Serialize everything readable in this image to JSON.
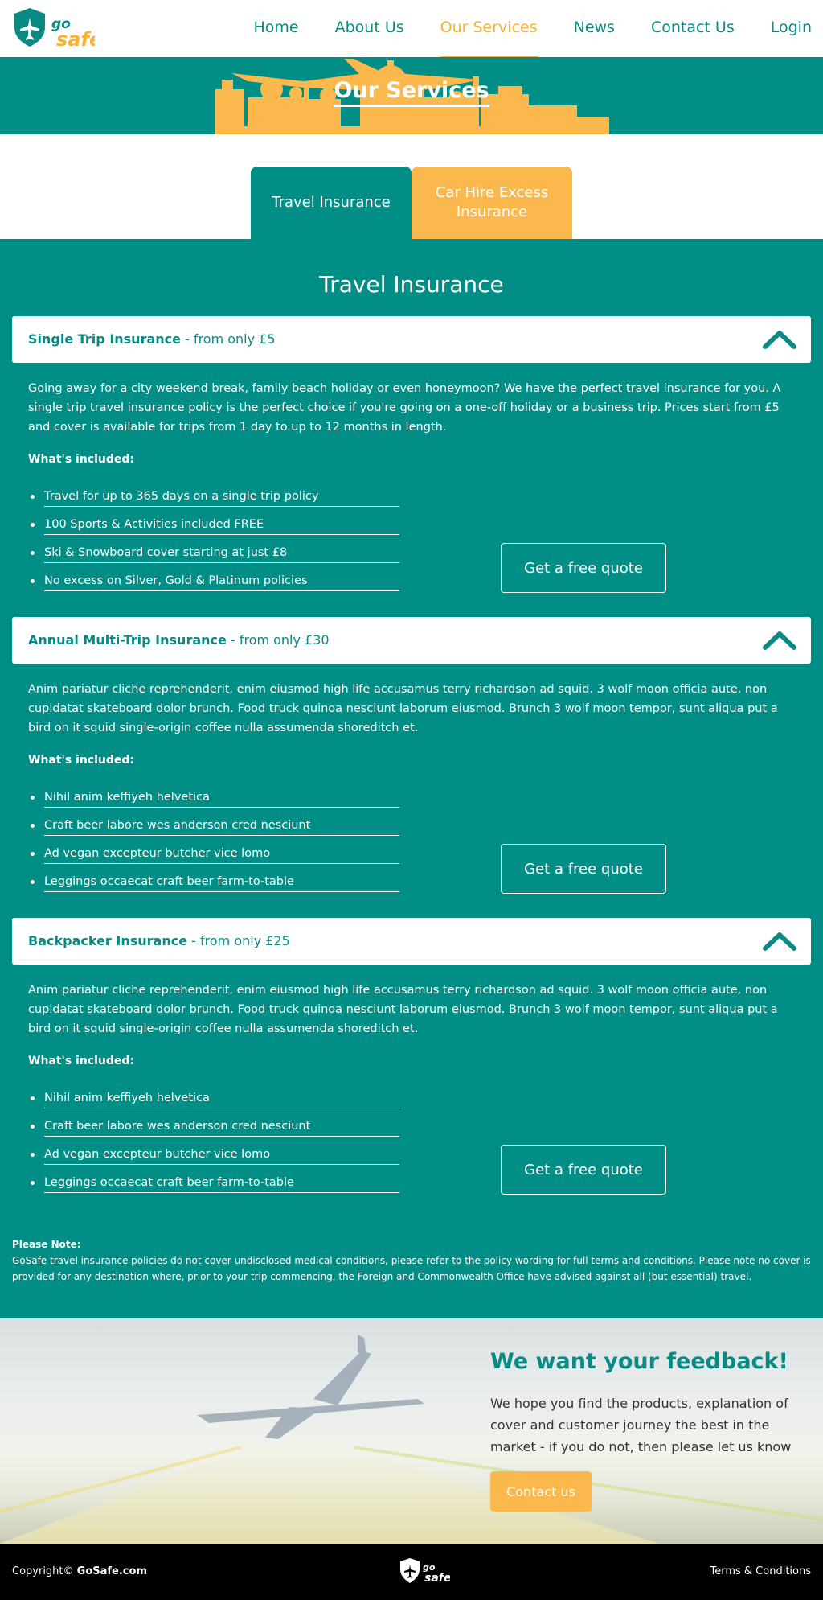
{
  "brand": {
    "logo_word": "go safe",
    "accent": "#f9b233",
    "teal": "#008e87"
  },
  "nav": {
    "items": [
      {
        "label": "Home"
      },
      {
        "label": "About Us"
      },
      {
        "label": "Our Services",
        "active": true
      },
      {
        "label": "News"
      },
      {
        "label": "Contact Us"
      },
      {
        "label": "Login"
      }
    ]
  },
  "hero": {
    "title": "Our Services"
  },
  "tabs": [
    {
      "label": "Travel Insurance",
      "active": true
    },
    {
      "label": "Car Hire Excess Insurance"
    }
  ],
  "section": {
    "title": "Travel Insurance"
  },
  "products": [
    {
      "name": "Single Trip Insurance",
      "price": " - from only £5",
      "description": "Going away for a city weekend break, family beach holiday or even honeymoon? We have the perfect travel insurance for you. A single trip travel insurance policy is the perfect choice if you're going on a one-off holiday or a business trip. Prices start from £5 and cover is available for trips from 1 day to up to 12 months in length.",
      "included_label": "What's included:",
      "included": [
        "Travel for up to 365 days on a single trip policy",
        "100 Sports & Activities included FREE",
        "Ski & Snowboard cover starting at just £8",
        "No excess on Silver, Gold & Platinum policies"
      ],
      "cta": "Get a free quote",
      "chevron_icon": "chevron-up-icon"
    },
    {
      "name": "Annual Multi-Trip Insurance",
      "price": " - from only £30",
      "description": "Anim pariatur cliche reprehenderit, enim eiusmod high life accusamus terry richardson ad squid. 3 wolf moon officia aute, non cupidatat skateboard dolor brunch. Food truck quinoa nesciunt laborum eiusmod. Brunch 3 wolf moon tempor, sunt aliqua put a bird on it squid single-origin coffee nulla assumenda shoreditch et.",
      "included_label": "What's included:",
      "included": [
        "Nihil anim keffiyeh helvetica",
        "Craft beer labore wes anderson cred nesciunt",
        "Ad vegan excepteur butcher vice lomo",
        "Leggings occaecat craft beer farm-to-table"
      ],
      "cta": "Get a free quote",
      "chevron_icon": "chevron-up-icon"
    },
    {
      "name": "Backpacker Insurance",
      "price": " - from only £25",
      "description": "Anim pariatur cliche reprehenderit, enim eiusmod high life accusamus terry richardson ad squid. 3 wolf moon officia aute, non cupidatat skateboard dolor brunch. Food truck quinoa nesciunt laborum eiusmod. Brunch 3 wolf moon tempor, sunt aliqua put a bird on it squid single-origin coffee nulla assumenda shoreditch et.",
      "included_label": "What's included:",
      "included": [
        "Nihil anim keffiyeh helvetica",
        "Craft beer labore wes anderson cred nesciunt",
        "Ad vegan excepteur butcher vice lomo",
        "Leggings occaecat craft beer farm-to-table"
      ],
      "cta": "Get a free quote",
      "chevron_icon": "chevron-up-icon"
    }
  ],
  "note": {
    "label": "Please Note:",
    "text": "GoSafe travel insurance policies do not cover undisclosed medical conditions, please refer to the policy wording for full terms and conditions. Please note no cover is provided for any destination where, prior to your trip commencing, the Foreign and Commonwealth Office have advised against all (but essential) travel."
  },
  "feedback": {
    "title": "We want your feedback!",
    "text": "We hope you find the products, explanation of cover and customer journey the best in the market - if you do not, then please let us know",
    "button": "Contact us"
  },
  "footer": {
    "copyright_prefix": "Copyright© ",
    "copyright_brand": "GoSafe.com",
    "terms": "Terms & Conditions"
  }
}
